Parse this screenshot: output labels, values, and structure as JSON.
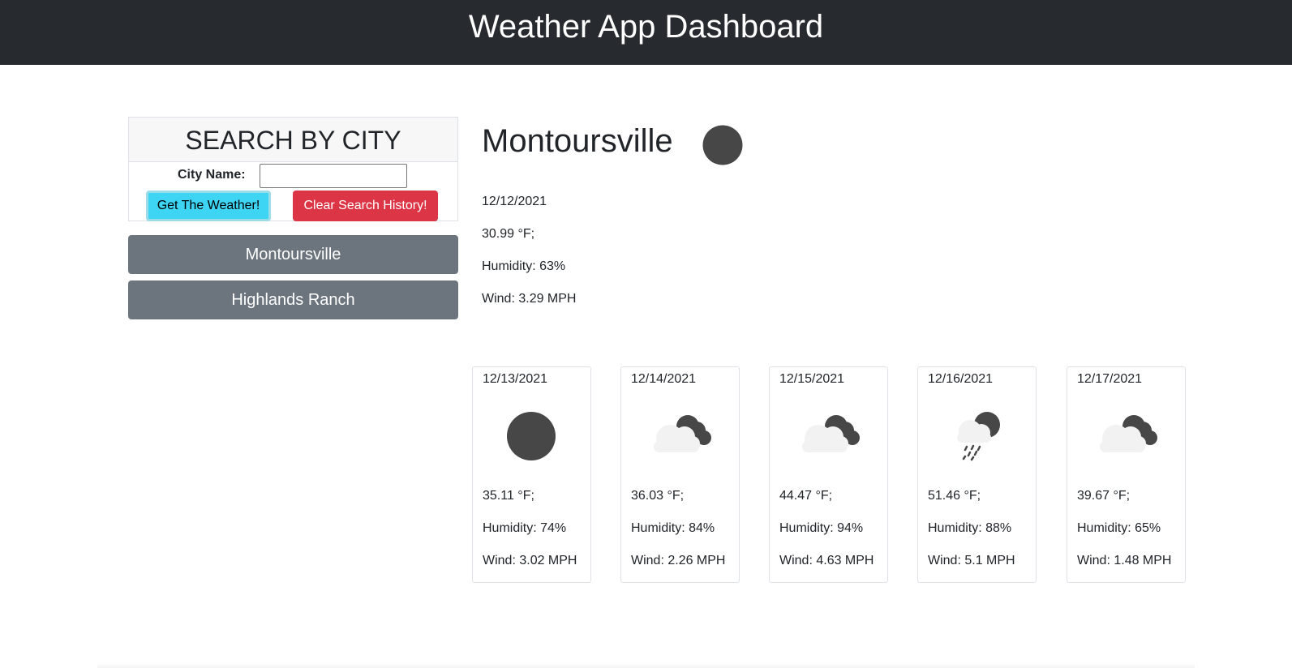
{
  "header": {
    "title": "Weather App Dashboard"
  },
  "search": {
    "heading": "SEARCH BY CITY",
    "label": "City Name:",
    "input_value": "",
    "input_placeholder": "",
    "get_weather_label": "Get The Weather!",
    "clear_history_label": "Clear Search History!"
  },
  "history": [
    {
      "label": "Montoursville"
    },
    {
      "label": "Highlands Ranch"
    }
  ],
  "current": {
    "city": "Montoursville",
    "icon": "full-moon-icon",
    "date": "12/12/2021",
    "temp": "30.99 °F;",
    "humidity": "Humidity: 63%",
    "wind": "Wind: 3.29 MPH"
  },
  "forecast": [
    {
      "date": "12/13/2021",
      "icon": "full-moon-icon",
      "temp": "35.11 °F;",
      "humidity": "Humidity: 74%",
      "wind": "Wind: 3.02 MPH"
    },
    {
      "date": "12/14/2021",
      "icon": "cloudy-night-icon",
      "temp": "36.03 °F;",
      "humidity": "Humidity: 84%",
      "wind": "Wind: 2.26 MPH"
    },
    {
      "date": "12/15/2021",
      "icon": "cloudy-night-icon",
      "temp": "44.47 °F;",
      "humidity": "Humidity: 94%",
      "wind": "Wind: 4.63 MPH"
    },
    {
      "date": "12/16/2021",
      "icon": "rainy-night-icon",
      "temp": "51.46 °F;",
      "humidity": "Humidity: 88%",
      "wind": "Wind: 5.1 MPH"
    },
    {
      "date": "12/17/2021",
      "icon": "cloudy-night-icon",
      "temp": "39.67 °F;",
      "humidity": "Humidity: 65%",
      "wind": "Wind: 1.48 MPH"
    }
  ],
  "colors": {
    "navbar": "#272b30",
    "weather_button": "#3dd5f3",
    "clear_button": "#dc3545",
    "history_button": "#6c757d",
    "moon": "#474747",
    "cloud": "#f2f2f2"
  }
}
